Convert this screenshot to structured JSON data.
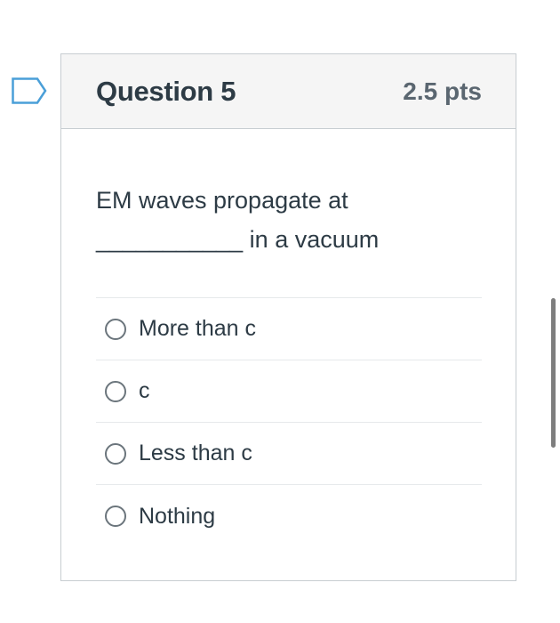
{
  "question": {
    "title": "Question 5",
    "points": "2.5 pts",
    "text_line1": "EM waves propagate at",
    "text_line2": "___________ in a vacuum",
    "answers": [
      {
        "label": "More than c",
        "selected": false
      },
      {
        "label": "c",
        "selected": false
      },
      {
        "label": "Less than c",
        "selected": false
      },
      {
        "label": "Nothing",
        "selected": false
      }
    ]
  },
  "icons": {
    "flag": "flag-outline-icon",
    "radio": "radio-unselected-icon"
  },
  "colors": {
    "flag_outline": "#4a9fd8",
    "header_bg": "#f5f5f5",
    "border": "#c7cdd1",
    "text": "#2d3b45",
    "points_text": "#5a6670",
    "scrollbar": "#7e7e7e"
  }
}
